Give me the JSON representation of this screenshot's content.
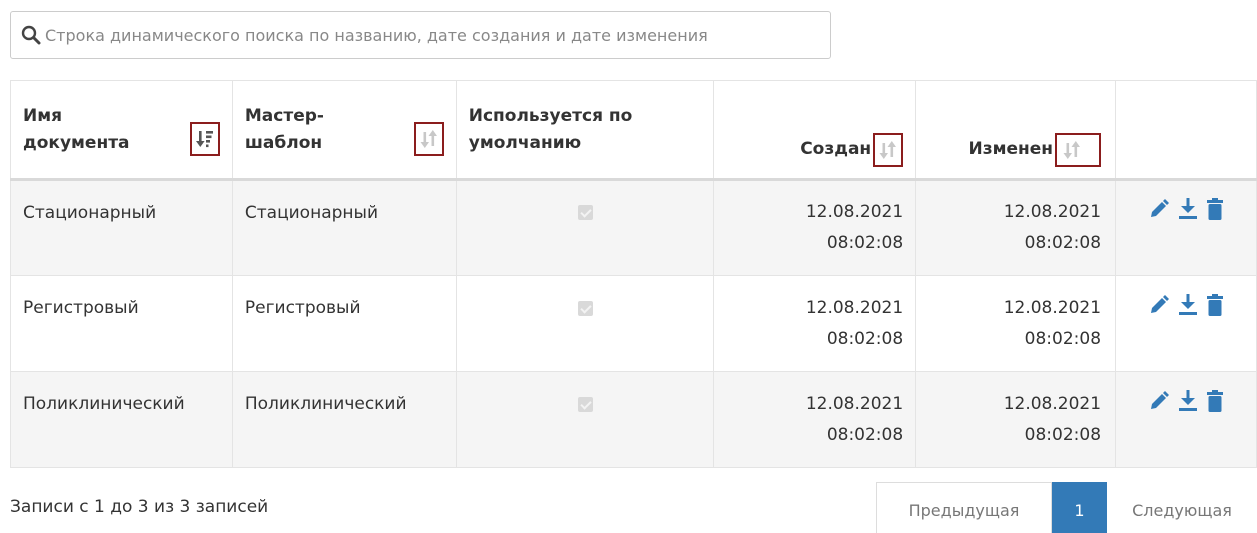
{
  "search": {
    "placeholder": "Строка динамического поиска по названию, дате создания и дате изменения"
  },
  "table": {
    "headers": {
      "name": [
        "Имя",
        "документа"
      ],
      "master": [
        "Мастер-",
        "шаблон"
      ],
      "default": [
        "Используется по",
        "умолчанию"
      ],
      "created": "Создан",
      "modified": "Изменен"
    },
    "rows": [
      {
        "name": "Стационарный",
        "master": "Стационарный",
        "is_default": true,
        "created_date": "12.08.2021",
        "created_time": "08:02:08",
        "modified_date": "12.08.2021",
        "modified_time": "08:02:08"
      },
      {
        "name": "Регистровый",
        "master": "Регистровый",
        "is_default": true,
        "created_date": "12.08.2021",
        "created_time": "08:02:08",
        "modified_date": "12.08.2021",
        "modified_time": "08:02:08"
      },
      {
        "name": "Поликлинический",
        "master": "Поликлинический",
        "is_default": true,
        "created_date": "12.08.2021",
        "created_time": "08:02:08",
        "modified_date": "12.08.2021",
        "modified_time": "08:02:08"
      }
    ]
  },
  "footer": {
    "info": "Записи с 1 до 3 из 3 записей",
    "prev": "Предыдущая",
    "current_page": "1",
    "next": "Следующая"
  },
  "colors": {
    "accent": "#337ab7",
    "sort_highlight": "#8b1d1d",
    "row_stripe": "#f5f5f5"
  },
  "icons": [
    "search-icon",
    "sort-desc-icon",
    "sort-icon",
    "checkbox-icon",
    "pencil-icon",
    "download-icon",
    "trash-icon"
  ]
}
